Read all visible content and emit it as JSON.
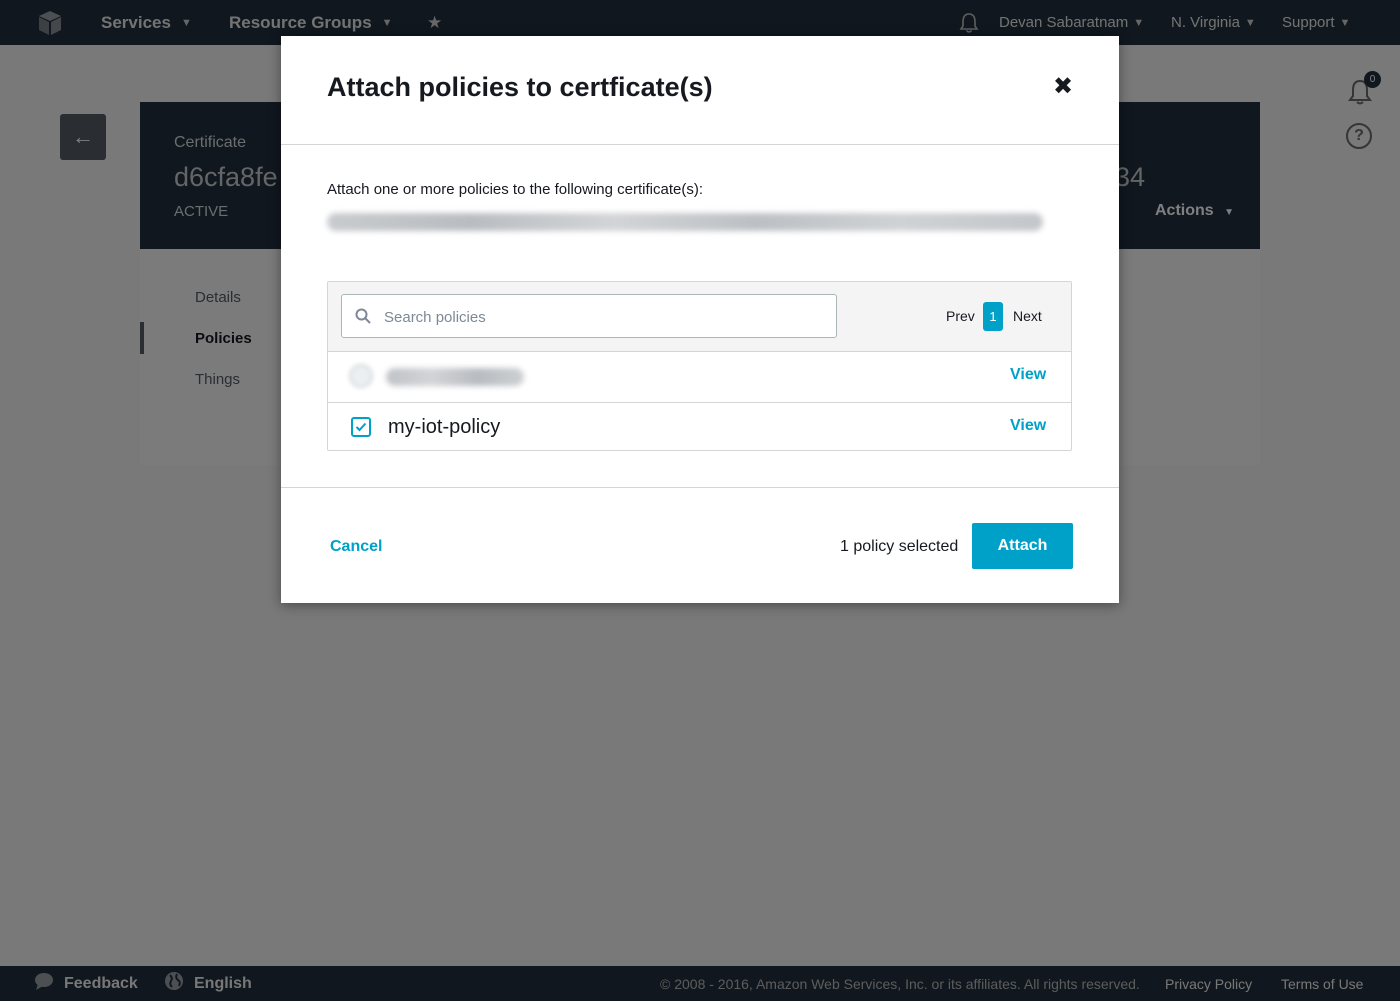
{
  "topbar": {
    "services": "Services",
    "resource_groups": "Resource Groups",
    "user": "Devan Sabaratnam",
    "region": "N. Virginia",
    "support": "Support",
    "icons": [
      "aws-cube-icon",
      "star-icon",
      "bell-icon"
    ]
  },
  "certificate": {
    "label": "Certificate",
    "id_prefix": "d6cfa8fe",
    "id_suffix": "34",
    "status": "ACTIVE",
    "actions": "Actions"
  },
  "sidenav": {
    "items": [
      {
        "label": "Details",
        "active": false
      },
      {
        "label": "Policies",
        "active": true
      },
      {
        "label": "Things",
        "active": false
      }
    ]
  },
  "right_rail": {
    "notification_count": "0"
  },
  "modal": {
    "title": "Attach policies to certficate(s)",
    "description": "Attach one or more policies to the following certificate(s):",
    "search": {
      "placeholder": "Search policies",
      "value": ""
    },
    "pagination": {
      "prev": "Prev",
      "current_page": "1",
      "next": "Next"
    },
    "policies": [
      {
        "name": "",
        "checked": false,
        "view_label": "View"
      },
      {
        "name": "my-iot-policy",
        "checked": true,
        "view_label": "View"
      }
    ],
    "cancel_label": "Cancel",
    "selected_count": "1 policy selected",
    "attach_label": "Attach"
  },
  "footer": {
    "feedback": "Feedback",
    "language": "English",
    "copyright": "© 2008 - 2016, Amazon Web Services, Inc. or its affiliates. All rights reserved.",
    "privacy": "Privacy Policy",
    "terms": "Terms of Use"
  },
  "colors": {
    "nav_bg": "#232f3e",
    "accent": "#00a1c9",
    "overlay": "rgba(0,0,0,0.5)"
  }
}
